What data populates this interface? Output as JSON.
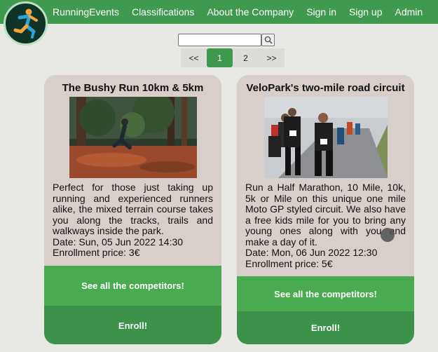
{
  "nav": {
    "items": [
      "RunningEvents",
      "Classifications",
      "About the Company",
      "Sign in",
      "Sign up",
      "Admin"
    ]
  },
  "search": {
    "placeholder": "",
    "value": ""
  },
  "pagination": {
    "prev": "<<",
    "pages": [
      "1",
      "2"
    ],
    "current": "1",
    "next": ">>"
  },
  "events": [
    {
      "title": "The Bushy Run 10km & 5km",
      "description": "Perfect for those just taking up running and experienced runners alike, the mixed terrain course takes you along the tracks, trails and walkways inside the park.",
      "date": "Date: Sun, 05 Jun 2022 14:30",
      "price": "Enrollment price: 3€",
      "competitors_label": "See all the competitors!",
      "enroll_label": "Enroll!"
    },
    {
      "title": "VeloPark's two-mile road circuit",
      "description": "Run a Half Marathon, 10 Mile, 10k, 5k or Mile on this unique one mile Moto GP styled circuit. We also have a free kids mile for you to bring any young ones along with you and make a day of it.",
      "date": "Date: Mon, 06 Jun 2022 12:30",
      "price": "Enrollment price: 5€",
      "competitors_label": "See all the competitors!",
      "enroll_label": "Enroll!"
    }
  ],
  "colors": {
    "brand_green": "#3f9a4e",
    "button_green": "#4aaa4f",
    "enroll_green": "#3b9248",
    "card_bg": "#d8cfcb"
  }
}
